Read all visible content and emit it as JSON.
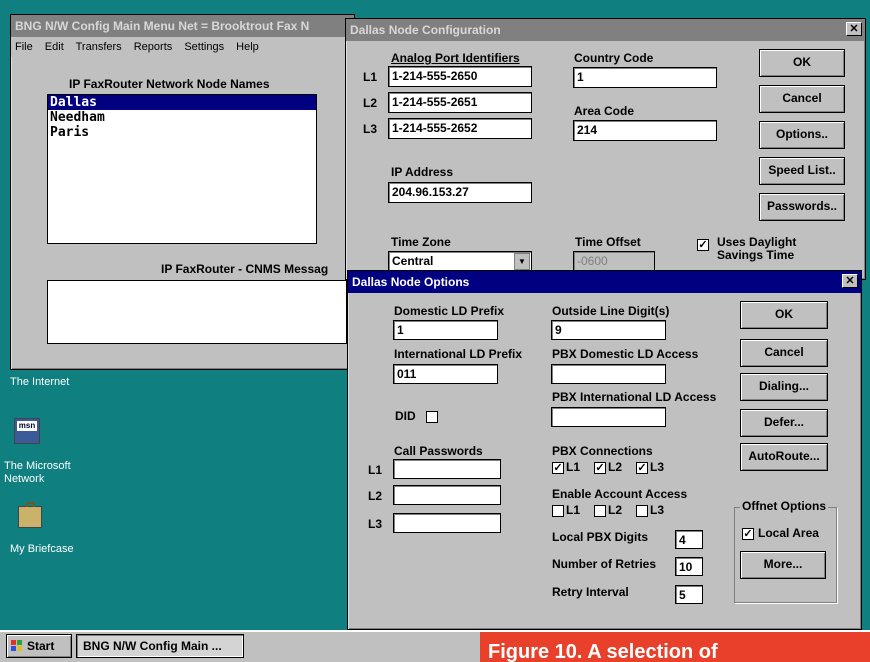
{
  "main_window": {
    "title": "BNG N/W Config Main Menu Net = Brooktrout Fax N",
    "menus": [
      "File",
      "Edit",
      "Transfers",
      "Reports",
      "Settings",
      "Help"
    ],
    "node_names_label": "IP FaxRouter Network Node Names",
    "nodes": [
      "Dallas",
      "Needham",
      "Paris"
    ],
    "cnms_label": "IP FaxRouter - CNMS Messag"
  },
  "desktop": {
    "icons": [
      {
        "label": "The Internet",
        "icon": "internet-icon"
      },
      {
        "label": "The Microsoft Network",
        "icon": "msn-icon"
      },
      {
        "label": "My Briefcase",
        "icon": "briefcase-icon"
      }
    ]
  },
  "config_dialog": {
    "title": "Dallas Node Configuration",
    "analog_label": "Analog Port Identifiers",
    "lines": [
      {
        "label": "L1",
        "value": "1-214-555-2650"
      },
      {
        "label": "L2",
        "value": "1-214-555-2651"
      },
      {
        "label": "L3",
        "value": "1-214-555-2652"
      }
    ],
    "country_code_label": "Country Code",
    "country_code": "1",
    "area_code_label": "Area Code",
    "area_code": "214",
    "ip_label": "IP Address",
    "ip": "204.96.153.27",
    "time_zone_label": "Time Zone",
    "time_zone": "Central",
    "time_offset_label": "Time Offset",
    "time_offset": "-0600",
    "dst_label": "Uses Daylight Savings Time",
    "buttons": [
      "OK",
      "Cancel",
      "Options..",
      "Speed List..",
      "Passwords.."
    ]
  },
  "options_dialog": {
    "title": "Dallas Node Options",
    "domestic_ld_label": "Domestic LD Prefix",
    "domestic_ld": "1",
    "international_ld_label": "International LD Prefix",
    "international_ld": "011",
    "did_label": "DID",
    "call_passwords_label": "Call Passwords",
    "pw_lines": [
      "L1",
      "L2",
      "L3"
    ],
    "outside_line_label": "Outside Line Digit(s)",
    "outside_line": "9",
    "pbx_domestic_label": "PBX Domestic LD Access",
    "pbx_international_label": "PBX International LD Access",
    "pbx_connections_label": "PBX Connections",
    "pbx_conn": [
      "L1",
      "L2",
      "L3"
    ],
    "enable_account_label": "Enable Account Access",
    "acct": [
      "L1",
      "L2",
      "L3"
    ],
    "local_pbx_digits_label": "Local PBX Digits",
    "local_pbx_digits": "4",
    "retries_label": "Number of Retries",
    "retries": "10",
    "retry_interval_label": "Retry Interval",
    "retry_interval": "5",
    "buttons": [
      "OK",
      "Cancel",
      "Dialing...",
      "Defer...",
      "AutoRoute..."
    ],
    "offnet_label": "Offnet Options",
    "local_area_label": "Local Area",
    "more_button": "More..."
  },
  "taskbar": {
    "start": "Start",
    "task": "BNG N/W Config Main ..."
  },
  "caption": "Figure 10. A selection of",
  "colors": {
    "desktop": "#0f7f7f",
    "title_active": "#000080",
    "caption": "#e8402a"
  }
}
